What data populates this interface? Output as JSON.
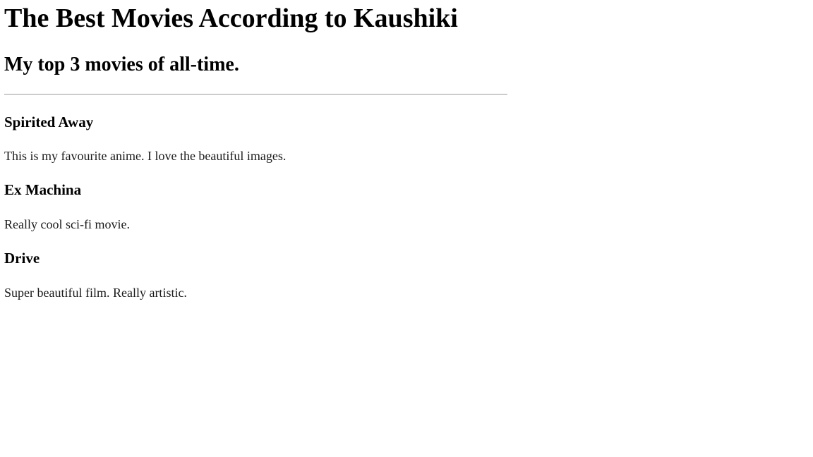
{
  "page": {
    "title": "The Best Movies According to Kaushiki",
    "subtitle": "My top 3 movies of all-time."
  },
  "movies": [
    {
      "title": "Spirited Away",
      "description": "This is my favourite anime. I love the beautiful images."
    },
    {
      "title": "Ex Machina",
      "description": "Really cool sci-fi movie."
    },
    {
      "title": "Drive",
      "description": "Super beautiful film. Really artistic."
    }
  ]
}
